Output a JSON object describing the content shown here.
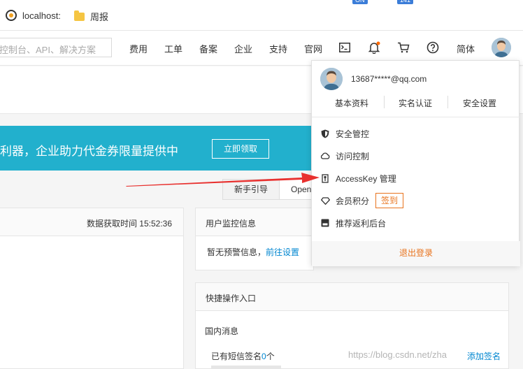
{
  "bookmarks": {
    "items": [
      {
        "label": "localhost:",
        "icon": "site-favicon-icon"
      },
      {
        "label": "周报",
        "icon": "folder-icon"
      }
    ],
    "extension_badges": [
      "ON",
      "141"
    ]
  },
  "topnav": {
    "search_placeholder": "控制台、API、解决方案",
    "items": [
      "费用",
      "工单",
      "备案",
      "企业",
      "支持",
      "官网"
    ],
    "icons": [
      "terminal-icon",
      "bell-icon",
      "cart-icon",
      "help-icon"
    ],
    "language": "简体",
    "notification_dot_color": "#ff6a00"
  },
  "banner": {
    "text": "利器，企业助力代金券限量提供中",
    "button": "立即领取",
    "color": "#22b0cd"
  },
  "tabs": {
    "guide": "新手引导",
    "open": "Open"
  },
  "left_card": {
    "fetch_time": "数据获取时间 15:52:36"
  },
  "monitor": {
    "title": "用户监控信息",
    "no_alert": "暂无预警信息，",
    "goto_settings": "前往设置"
  },
  "quick": {
    "title": "快捷操作入口",
    "domestic": "国内消息",
    "sms_prefix": "已有短信签名",
    "sms_count": "0",
    "sms_suffix": "个",
    "add_sign": "添加签名"
  },
  "watermark": "https://blog.csdn.net/zha",
  "dropdown": {
    "email": "13687*****@qq.com",
    "links": [
      "基本资料",
      "实名认证",
      "安全设置"
    ],
    "menu": [
      {
        "label": "安全管控",
        "icon": "shield-icon"
      },
      {
        "label": "访问控制",
        "icon": "cloud-icon"
      },
      {
        "label": "AccessKey 管理",
        "icon": "key-icon"
      },
      {
        "label": "会员积分",
        "icon": "diamond-icon"
      },
      {
        "label": "推荐返利后台",
        "icon": "gift-icon"
      }
    ],
    "checkin": "签到",
    "logout": "退出登录",
    "accent": "#e8731d"
  },
  "annotation": {
    "arrow_color": "#e8312f"
  }
}
